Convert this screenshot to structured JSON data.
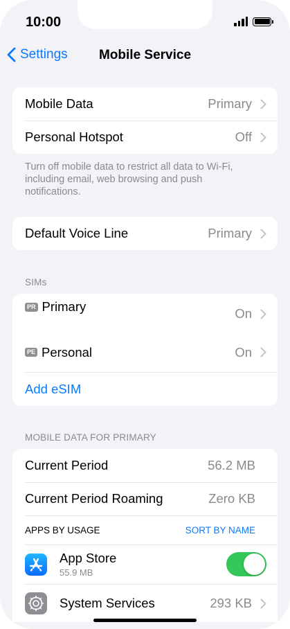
{
  "status_bar": {
    "time": "10:00"
  },
  "nav": {
    "back_label": "Settings",
    "title": "Mobile Service"
  },
  "group1": {
    "rows": [
      {
        "label": "Mobile Data",
        "value": "Primary"
      },
      {
        "label": "Personal Hotspot",
        "value": "Off"
      }
    ],
    "footnote": "Turn off mobile data to restrict all data to Wi-Fi, including email, web browsing and push notifications."
  },
  "voice": {
    "label": "Default Voice Line",
    "value": "Primary"
  },
  "sims": {
    "header": "SIMs",
    "items": [
      {
        "badge": "PR",
        "label": "Primary",
        "value": "On"
      },
      {
        "badge": "PE",
        "label": "Personal",
        "value": "On"
      }
    ],
    "add_label": "Add eSIM"
  },
  "usage": {
    "header": "MOBILE DATA FOR PRIMARY",
    "rows": [
      {
        "label": "Current Period",
        "value": "56.2 MB"
      },
      {
        "label": "Current Period Roaming",
        "value": "Zero KB"
      }
    ],
    "apps_header": "APPS BY USAGE",
    "sort_label": "SORT BY NAME",
    "apps": [
      {
        "name": "App Store",
        "size": "55.9 MB",
        "icon": "app-store-icon",
        "enabled": true
      },
      {
        "name": "System Services",
        "value": "293 KB",
        "icon": "gear-icon"
      }
    ]
  },
  "colors": {
    "accent": "#0a7aff",
    "toggle_on": "#34c759",
    "background": "#f2f2f7"
  }
}
